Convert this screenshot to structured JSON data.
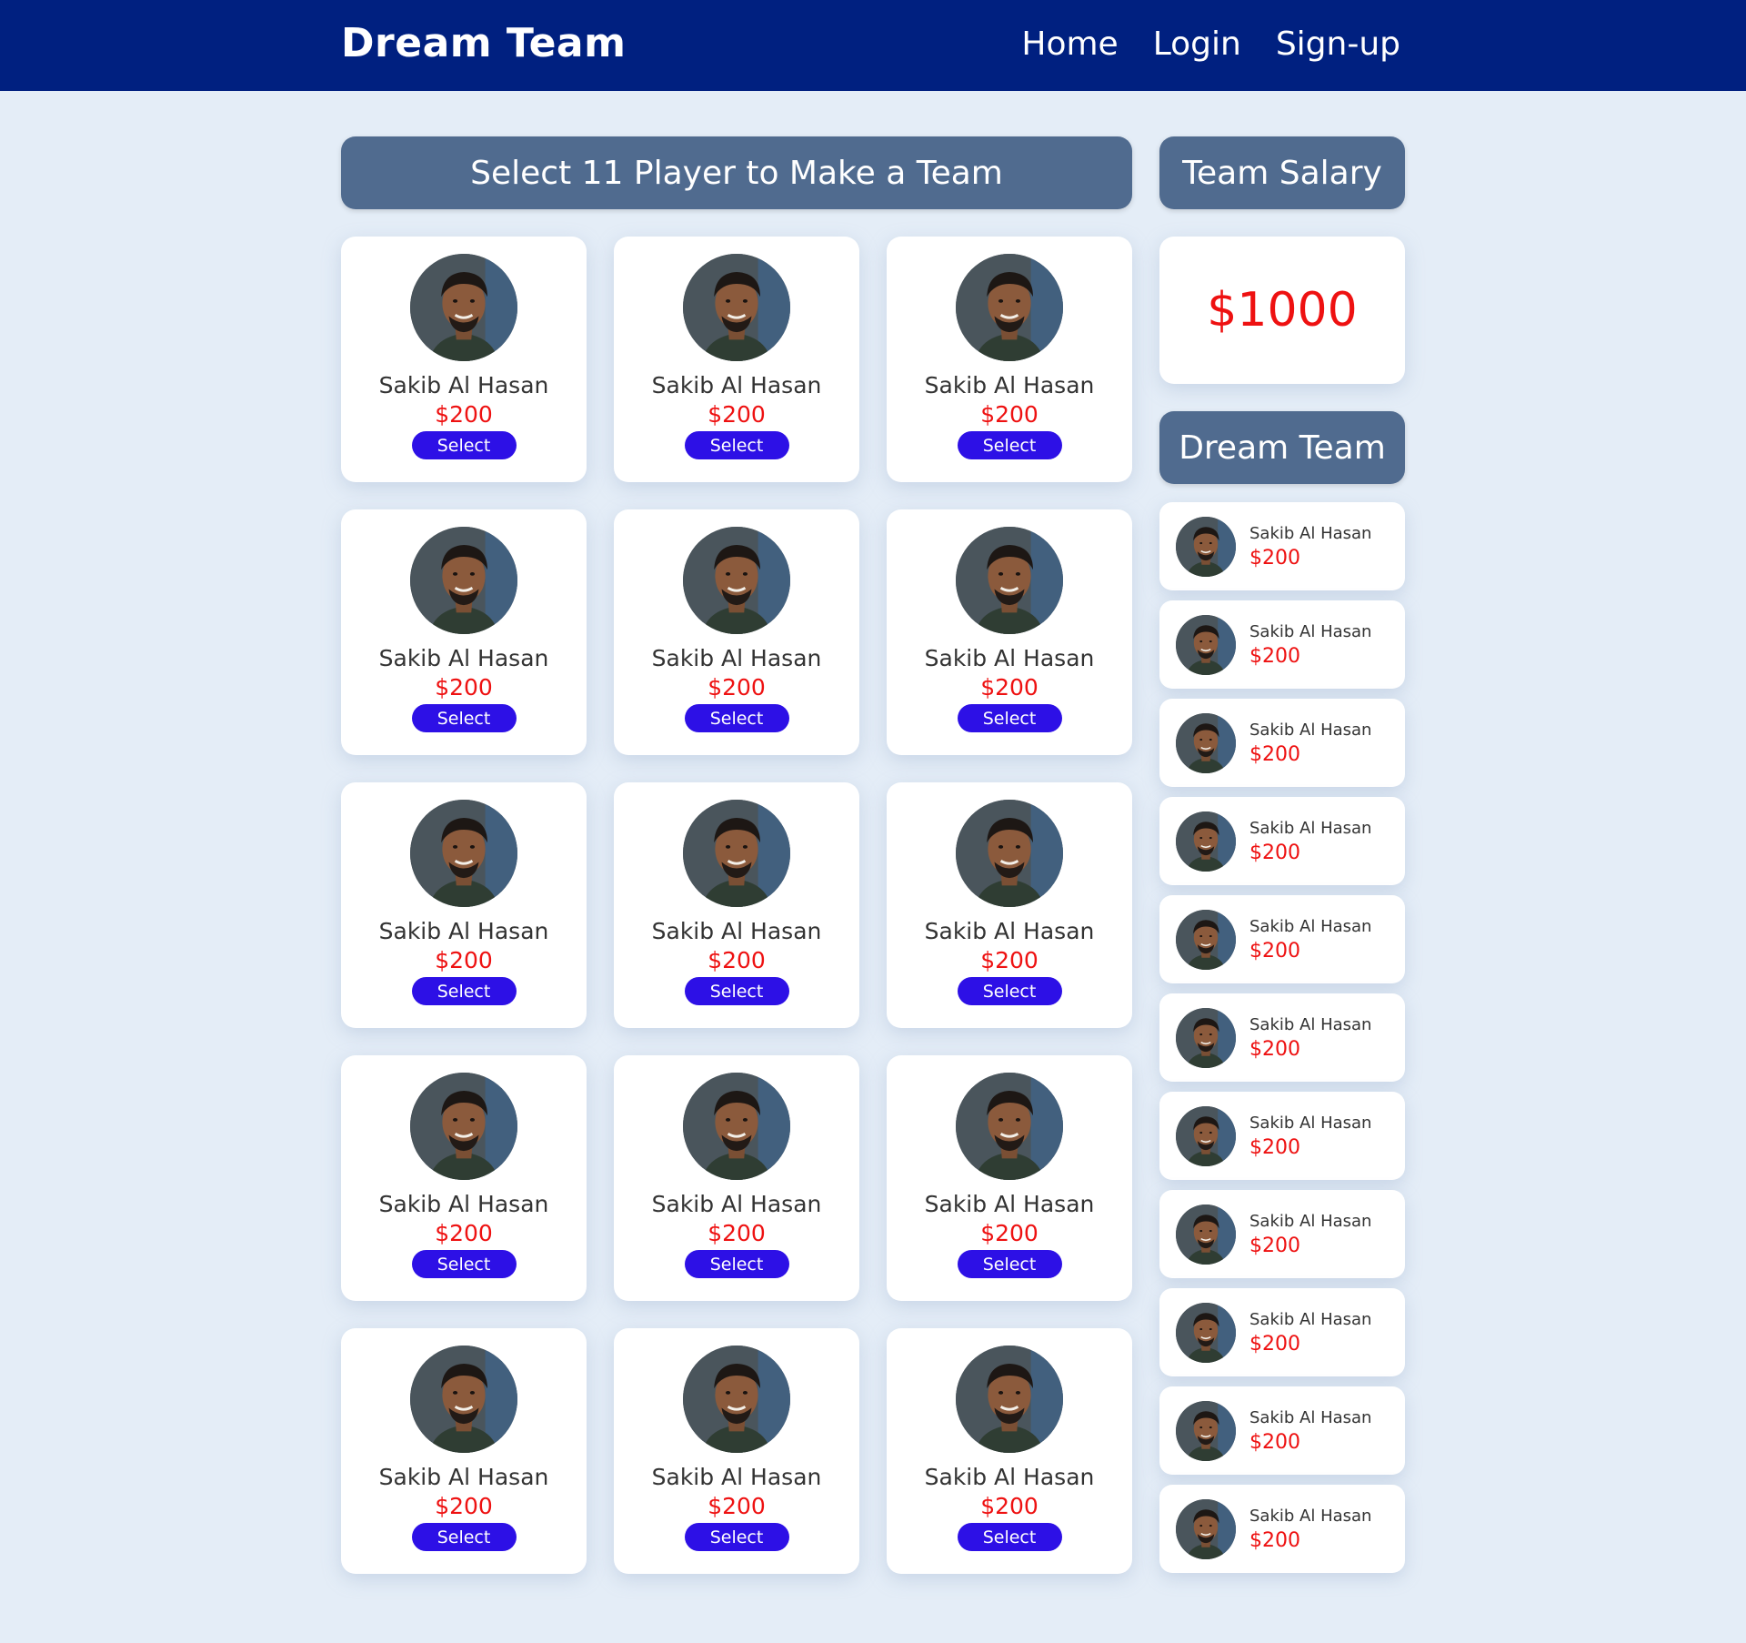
{
  "navbar": {
    "brand": "Dream Team",
    "links": [
      "Home",
      "Login",
      "Sign-up"
    ]
  },
  "players_section": {
    "heading": "Select 11 Player to Make a Team",
    "players": [
      {
        "name": "Sakib Al Hasan",
        "price": "$200",
        "button": "Select"
      },
      {
        "name": "Sakib Al Hasan",
        "price": "$200",
        "button": "Select"
      },
      {
        "name": "Sakib Al Hasan",
        "price": "$200",
        "button": "Select"
      },
      {
        "name": "Sakib Al Hasan",
        "price": "$200",
        "button": "Select"
      },
      {
        "name": "Sakib Al Hasan",
        "price": "$200",
        "button": "Select"
      },
      {
        "name": "Sakib Al Hasan",
        "price": "$200",
        "button": "Select"
      },
      {
        "name": "Sakib Al Hasan",
        "price": "$200",
        "button": "Select"
      },
      {
        "name": "Sakib Al Hasan",
        "price": "$200",
        "button": "Select"
      },
      {
        "name": "Sakib Al Hasan",
        "price": "$200",
        "button": "Select"
      },
      {
        "name": "Sakib Al Hasan",
        "price": "$200",
        "button": "Select"
      },
      {
        "name": "Sakib Al Hasan",
        "price": "$200",
        "button": "Select"
      },
      {
        "name": "Sakib Al Hasan",
        "price": "$200",
        "button": "Select"
      },
      {
        "name": "Sakib Al Hasan",
        "price": "$200",
        "button": "Select"
      },
      {
        "name": "Sakib Al Hasan",
        "price": "$200",
        "button": "Select"
      },
      {
        "name": "Sakib Al Hasan",
        "price": "$200",
        "button": "Select"
      }
    ]
  },
  "salary": {
    "heading": "Team Salary",
    "amount": "$1000"
  },
  "dream_team": {
    "heading": "Dream Team",
    "members": [
      {
        "name": "Sakib Al Hasan",
        "price": "$200"
      },
      {
        "name": "Sakib Al Hasan",
        "price": "$200"
      },
      {
        "name": "Sakib Al Hasan",
        "price": "$200"
      },
      {
        "name": "Sakib Al Hasan",
        "price": "$200"
      },
      {
        "name": "Sakib Al Hasan",
        "price": "$200"
      },
      {
        "name": "Sakib Al Hasan",
        "price": "$200"
      },
      {
        "name": "Sakib Al Hasan",
        "price": "$200"
      },
      {
        "name": "Sakib Al Hasan",
        "price": "$200"
      },
      {
        "name": "Sakib Al Hasan",
        "price": "$200"
      },
      {
        "name": "Sakib Al Hasan",
        "price": "$200"
      },
      {
        "name": "Sakib Al Hasan",
        "price": "$200"
      }
    ]
  },
  "colors": {
    "navbar": "#002080",
    "page_background": "#e4edf7",
    "heading_box": "#506b8f",
    "price": "#ee1111",
    "select_button": "#2d10e6"
  },
  "icons": {
    "player_photo": "player-photo-icon"
  }
}
